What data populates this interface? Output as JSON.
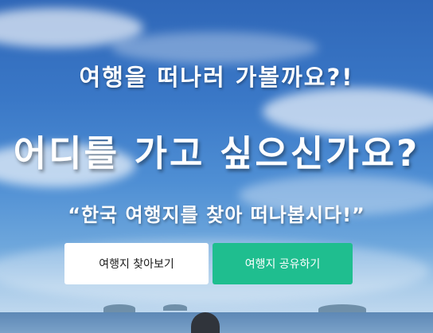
{
  "hero": {
    "subtitle": "여행을 떠나러 가볼까요?!",
    "title": "어디를 가고 싶으신가요?",
    "quote": "“한국 여행지를 찾아 떠나봅시다!”"
  },
  "buttons": {
    "find_label": "여행지 찾아보기",
    "share_label": "여행지 공유하기"
  },
  "colors": {
    "accent_green": "#1fbe8f",
    "button_white": "#ffffff",
    "sky_blue": "#3a78c7"
  }
}
